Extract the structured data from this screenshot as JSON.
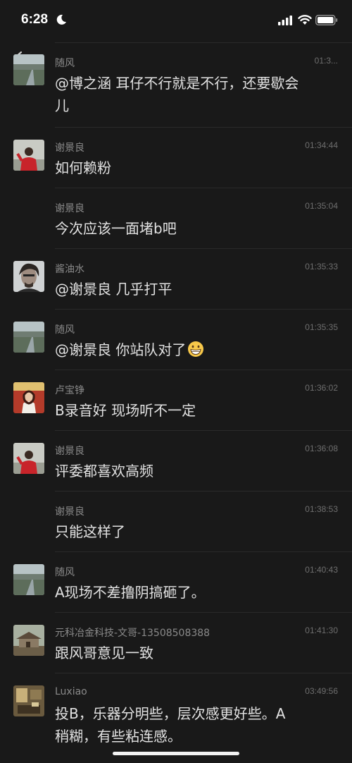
{
  "status_bar": {
    "time": "6:28"
  },
  "messages": [
    {
      "sender": "随风",
      "time": "01:3...",
      "text_line1": "@博之涵 耳仔不行就是不行，还要歇会",
      "text_line2": "儿",
      "avatar": "landscape-road"
    },
    {
      "sender": "谢景良",
      "time": "01:34:44",
      "text": "如何赖粉",
      "avatar": "person-red-jacket"
    },
    {
      "sender": "谢景良",
      "time": "01:35:04",
      "text": "今次应该一面堵b吧",
      "avatar": ""
    },
    {
      "sender": "酱油水",
      "time": "01:35:33",
      "text": "@谢景良 几乎打平",
      "avatar": "portrait-man"
    },
    {
      "sender": "随风",
      "time": "01:35:35",
      "text": "@谢景良 你站队对了",
      "avatar": "landscape-road",
      "emoji": "grinning-face"
    },
    {
      "sender": "卢宝铮",
      "time": "01:36:02",
      "text": "B录音好 现场听不一定",
      "avatar": "person-red-background"
    },
    {
      "sender": "谢景良",
      "time": "01:36:08",
      "text": "评委都喜欢高频",
      "avatar": "person-red-jacket"
    },
    {
      "sender": "谢景良",
      "time": "01:38:53",
      "text": "只能这样了",
      "avatar": ""
    },
    {
      "sender": "随风",
      "time": "01:40:43",
      "text": "A现场不差撸阴搞砸了。",
      "avatar": "landscape-road"
    },
    {
      "sender": "元科冶金科技-文哥-13508508388",
      "time": "01:41:30",
      "text": "跟风哥意见一致",
      "avatar": "village-house"
    },
    {
      "sender": "Luxiao",
      "time": "03:49:56",
      "text_line1": "投B，乐器分明些，层次感更好些。A",
      "text_line2": "稍糊，有些粘连感。",
      "avatar": "room-interior"
    }
  ]
}
